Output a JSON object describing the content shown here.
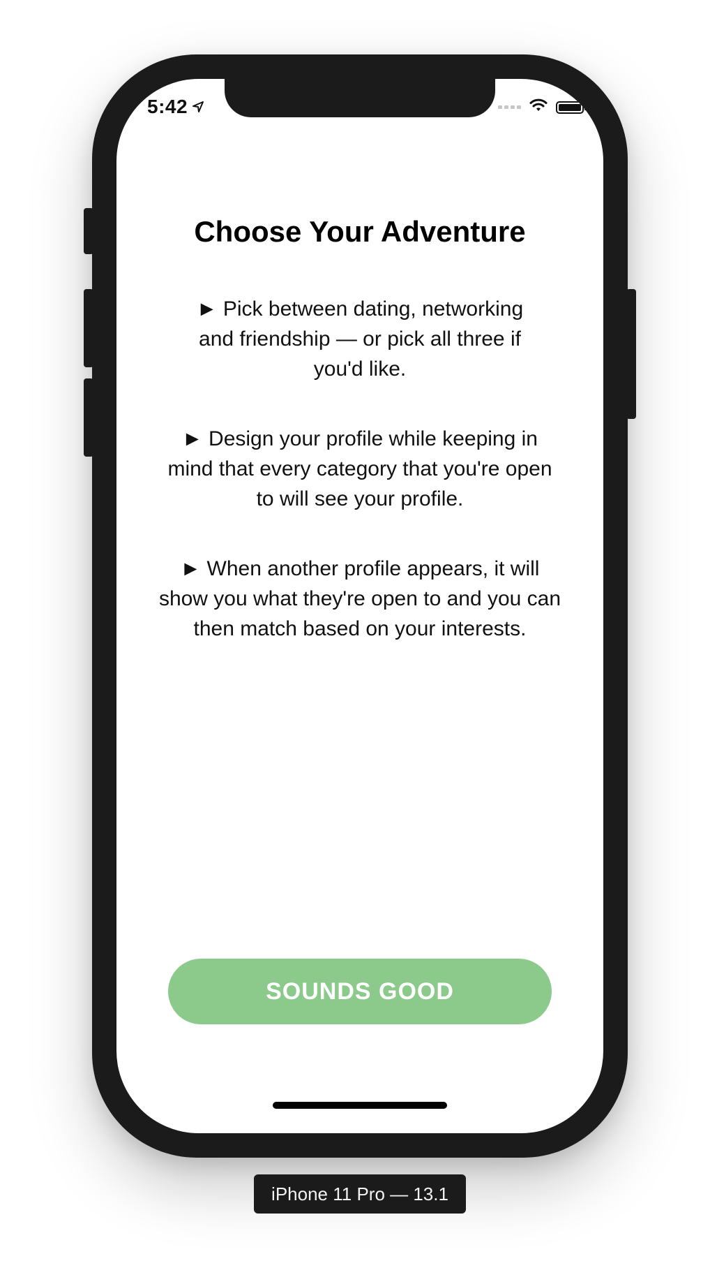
{
  "status_bar": {
    "time": "5:42",
    "location_icon": "location-arrow-icon",
    "signal_icon": "cellular-signal-icon",
    "wifi_icon": "wifi-icon",
    "battery_icon": "battery-icon",
    "battery_level": 1.0
  },
  "screen": {
    "title": "Choose Your Adventure",
    "instructions": [
      "►  Pick between dating, networking and friendship — or pick all three if you'd like.",
      "►  Design your profile while keeping in mind that every category that you're open to will see your profile.",
      "► When another profile appears, it will show you what they're open to and you can then match based on your interests."
    ],
    "cta_label": "SOUNDS GOOD"
  },
  "simulator": {
    "device_label": "iPhone 11 Pro — 13.1"
  },
  "colors": {
    "cta_background": "#8bca8b",
    "cta_text": "#ffffff",
    "device_frame": "#1b1b1b"
  }
}
